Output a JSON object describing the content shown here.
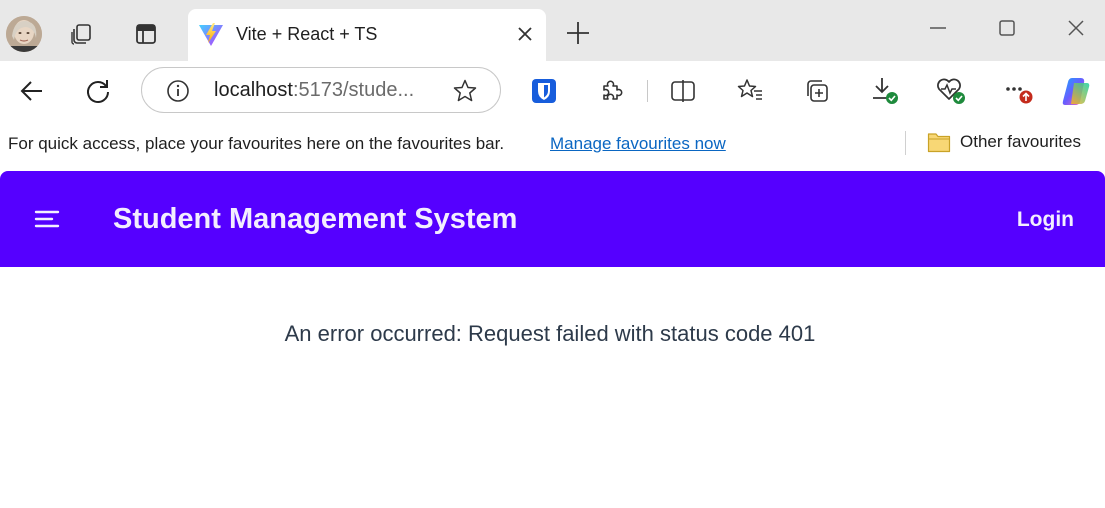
{
  "browser": {
    "tab": {
      "title": "Vite + React + TS",
      "favicon": "vite-logo"
    },
    "icons": {
      "workspaces": "workspaces-icon",
      "vertical_tabs": "vertical-tabs-icon",
      "new_tab": "plus-icon",
      "close_tab": "close-icon"
    },
    "address": {
      "host": "localhost",
      "path": ":5173/stude..."
    },
    "toolbar_icons": [
      "bitwarden-icon",
      "extensions-icon",
      "split-screen-icon",
      "favourites-icon",
      "collections-icon",
      "downloads-icon",
      "browser-essentials-icon",
      "more-icon",
      "copilot-icon"
    ],
    "favourites_bar": {
      "message": "For quick access, place your favourites here on the favourites bar.",
      "link": "Manage favourites now",
      "other": "Other favourites"
    },
    "colors": {
      "tabstrip": "#e8e8e8",
      "link": "#0a66c2"
    }
  },
  "app": {
    "title": "Student Management System",
    "login_label": "Login",
    "error_message": "An error occurred: Request failed with status code 401",
    "colors": {
      "header": "#5500ff",
      "header_text": "#f3eeff",
      "error_text": "#2d3a4a"
    }
  }
}
